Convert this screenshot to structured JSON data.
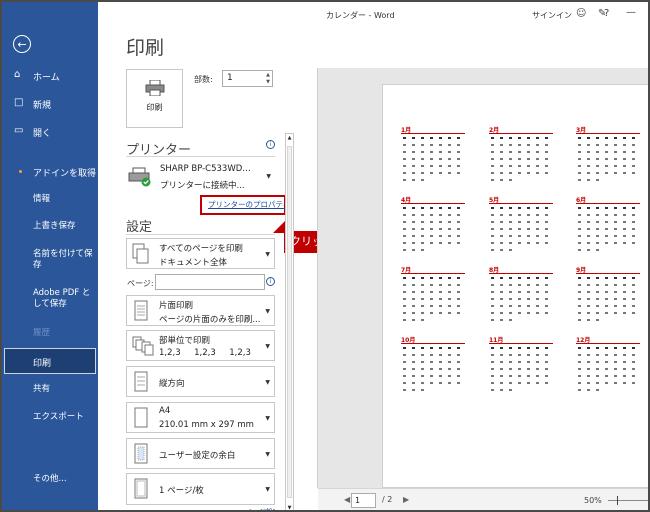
{
  "titlebar": {
    "title": "カレンダー  -  Word",
    "signin": "サインイン",
    "help": "?",
    "minimize": "—",
    "coauthor_icon": "person-icon",
    "comment_icon": "comment-icon"
  },
  "sidebar": {
    "back_icon": "back-arrow-icon",
    "items": [
      {
        "label": "ホーム",
        "icon": "home-icon"
      },
      {
        "label": "新規",
        "icon": "new-doc-icon"
      },
      {
        "label": "開く",
        "icon": "folder-icon"
      },
      {
        "label": "アドインを取得"
      },
      {
        "label": "情報"
      },
      {
        "label": "上書き保存"
      },
      {
        "label": "名前を付けて保存"
      },
      {
        "label": "Adobe PDF として保存"
      },
      {
        "label": "履歴"
      },
      {
        "label": "印刷"
      },
      {
        "label": "共有"
      },
      {
        "label": "エクスポート"
      },
      {
        "label": "その他..."
      }
    ]
  },
  "print": {
    "title": "印刷",
    "print_button": "印刷",
    "copies_label": "部数:",
    "copies_value": "1",
    "printer_section": "プリンター",
    "printer_name": "SHARP BP-C533WD…",
    "printer_status": "プリンターに接続中...",
    "printer_properties": "プリンターのプロパティ",
    "callout": "クリック",
    "settings_section": "設定",
    "range_line1": "すべてのページを印刷",
    "range_line2": "ドキュメント全体",
    "pages_label": "ページ:",
    "pages_value": "",
    "sides_line1": "片面印刷",
    "sides_line2": "ページの片面のみを印刷...",
    "collate_line1": "部単位で印刷",
    "collate_line2": "1,2,3     1,2,3     1,2,3",
    "orientation": "縦方向",
    "paper_line1": "A4",
    "paper_line2": "210.01 mm x 297 mm",
    "margins": "ユーザー設定の余白",
    "per_sheet": "1 ページ/枚",
    "page_setup_partial": "ページ設定"
  },
  "preview": {
    "months": [
      "1月",
      "2月",
      "3月",
      "4月",
      "5月",
      "6月",
      "7月",
      "8月",
      "9月",
      "10月",
      "11月",
      "12月"
    ],
    "page_current": "1",
    "page_total": "/ 2",
    "zoom": "50%"
  },
  "colors": {
    "sidebar_bg": "#2b579a",
    "accent_red": "#c00000",
    "link": "#1a4b9c"
  }
}
